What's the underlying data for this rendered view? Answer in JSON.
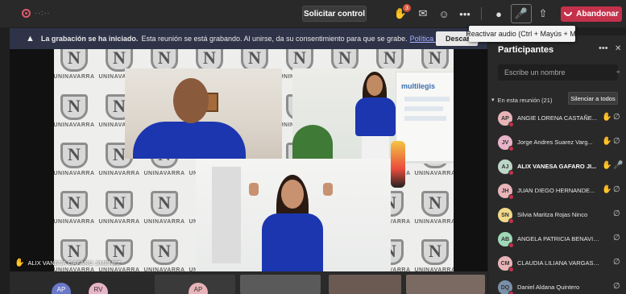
{
  "topbar": {
    "timer": "··:··",
    "request_control_label": "Solicitar control",
    "raise_hand_badge": "3",
    "more_label": "•••",
    "leave_label": "Abandonar"
  },
  "tooltip": "Reactivar audio (Ctrl + Mayús + M)",
  "banner": {
    "title": "La grabación se ha iniciado.",
    "message": "Esta reunión se está grabando. Al unirse, da su consentimiento para que se grabe.",
    "link": "Política de privacidad",
    "dismiss_label": "Descar"
  },
  "stage": {
    "logo_word": "UNINAVARRA",
    "speaker_name": "ALIX VANESA GAFARO JIMENEZ",
    "poster_text": "multilegis"
  },
  "strip": {
    "avatars": [
      "AP",
      "RV",
      "AP"
    ]
  },
  "panel": {
    "title": "Participantes",
    "more": "•••",
    "search_placeholder": "Escribe un nombre",
    "section_label": "En esta reunión (21)",
    "mute_all_label": "Silenciar a todos",
    "participants": [
      {
        "initials": "AP",
        "name": "ANGIE LORENA CASTAÑE...",
        "color": "#e8b4b8",
        "hand": true,
        "bold": false
      },
      {
        "initials": "JV",
        "name": "Jorge Andres Suarez Varg...",
        "color": "#e8b4c8",
        "hand": true,
        "bold": false
      },
      {
        "initials": "AJ",
        "name": "ALIX VANESA GAFARO JI...",
        "color": "#bcd6c8",
        "hand": true,
        "bold": true
      },
      {
        "initials": "JH",
        "name": "JUAN DIEGO HERNANDE...",
        "color": "#e8b4b8",
        "hand": true,
        "bold": false
      },
      {
        "initials": "SN",
        "name": "Silvia Maritza Rojas Ninco",
        "color": "#f0d98a",
        "hand": false,
        "bold": false
      },
      {
        "initials": "AB",
        "name": "ANGELA PATRICIA BENAVIDE...",
        "color": "#9fd8b8",
        "hand": false,
        "bold": false
      },
      {
        "initials": "CM",
        "name": "CLAUDIA LILIANA VARGAS M...",
        "color": "#e8b4b8",
        "hand": false,
        "bold": false
      },
      {
        "initials": "DQ",
        "name": "Daniel Aldana Quintero",
        "color": "#7a8fa8",
        "hand": false,
        "bold": false
      }
    ]
  },
  "colors": {
    "leave": "#c4314b",
    "banner": "#2f3348",
    "link": "#a4b4ff",
    "shirt": "#1c36b0"
  }
}
